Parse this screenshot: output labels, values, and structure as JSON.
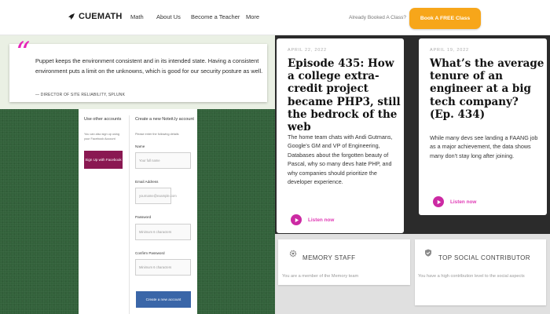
{
  "nav": {
    "logo": "CUEMATH",
    "links": [
      "Math",
      "About Us",
      "Become a Teacher",
      "More"
    ],
    "already_booked": "Already Booked A Class?",
    "cta": "Book A FREE Class"
  },
  "quote": {
    "text": "Puppet keeps the environment consistent and in its intended state. Having a consistent environment puts a limit on the unknowns, which is good for our security posture as well.",
    "attribution": "— DIRECTOR OF SITE RELIABILITY, SPLUNK"
  },
  "signup": {
    "left_title": "Use other accounts",
    "left_note": "You can also sign up using your Facebook Account",
    "facebook_button": "Sign Up with Facebook",
    "right_title": "Create a new Noteit.ly account",
    "right_note": "Please enter the following details",
    "fields": [
      {
        "label": "Name",
        "placeholder": "Your full name"
      },
      {
        "label": "Email Address",
        "placeholder": "yourname@example.com"
      },
      {
        "label": "Password",
        "placeholder": "Minimum 6 characters"
      },
      {
        "label": "Confirm Password",
        "placeholder": "Minimum 6 characters"
      }
    ],
    "submit": "Create a new account"
  },
  "episodes": [
    {
      "date": "APRIL 22, 2022",
      "title": "Episode 435: How a college extra-credit project became PHP3, still the bedrock of the web",
      "description": "The home team chats with Andi Gutmans, Google’s GM and VP of Engineering, Databases about the forgotten beauty of Pascal, why so many devs hate PHP, and why companies should prioritize the developer experience.",
      "listen": "Listen now"
    },
    {
      "date": "APRIL 19, 2022",
      "title": "What’s the average tenure of an engineer at a big tech company? (Ep. 434)",
      "description": "While many devs see landing a FAANG job as a major achievement, the data shows many don’t stay long after joining.",
      "listen": "Listen now"
    }
  ],
  "badges": [
    {
      "title": "MEMORY STAFF",
      "description": "You are a member of the Memory team",
      "icon": "gear-icon"
    },
    {
      "title": "TOP SOCIAL CONTRIBUTOR",
      "description": "You have a high contribution level to the social aspects",
      "icon": "shield-icon"
    }
  ],
  "colors": {
    "accent_orange": "#f7a61a",
    "quote_pink": "#e623b8",
    "facebook_purple": "#8a1852",
    "submit_blue": "#3a66a8",
    "listen_pink": "#cc2aa3",
    "felt_green": "#32613a"
  }
}
